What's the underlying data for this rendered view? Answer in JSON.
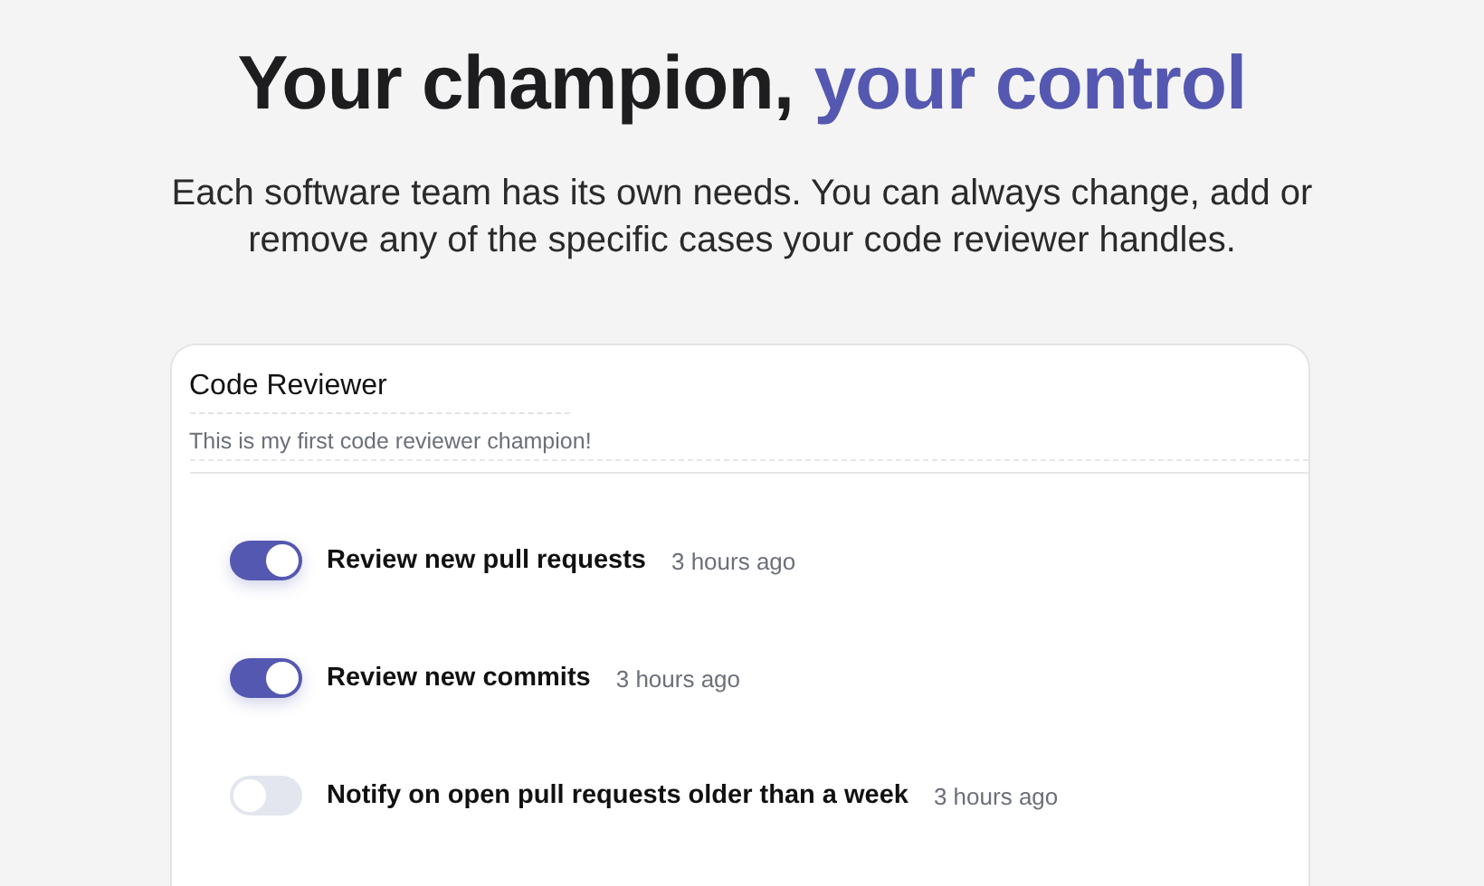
{
  "heading": {
    "text": "Your champion, ",
    "accent": "your control"
  },
  "subtitle": "Each software team has its own needs. You can always change, add or remove any of the specific cases your code reviewer handles.",
  "card": {
    "name": "Code Reviewer",
    "description": "This is my first code reviewer champion!",
    "cases": [
      {
        "label": "Review new pull requests",
        "time": "3 hours ago",
        "on": true
      },
      {
        "label": "Review new commits",
        "time": "3 hours ago",
        "on": true
      },
      {
        "label": "Notify on open pull requests older than a week",
        "time": "3 hours ago",
        "on": false
      }
    ]
  }
}
